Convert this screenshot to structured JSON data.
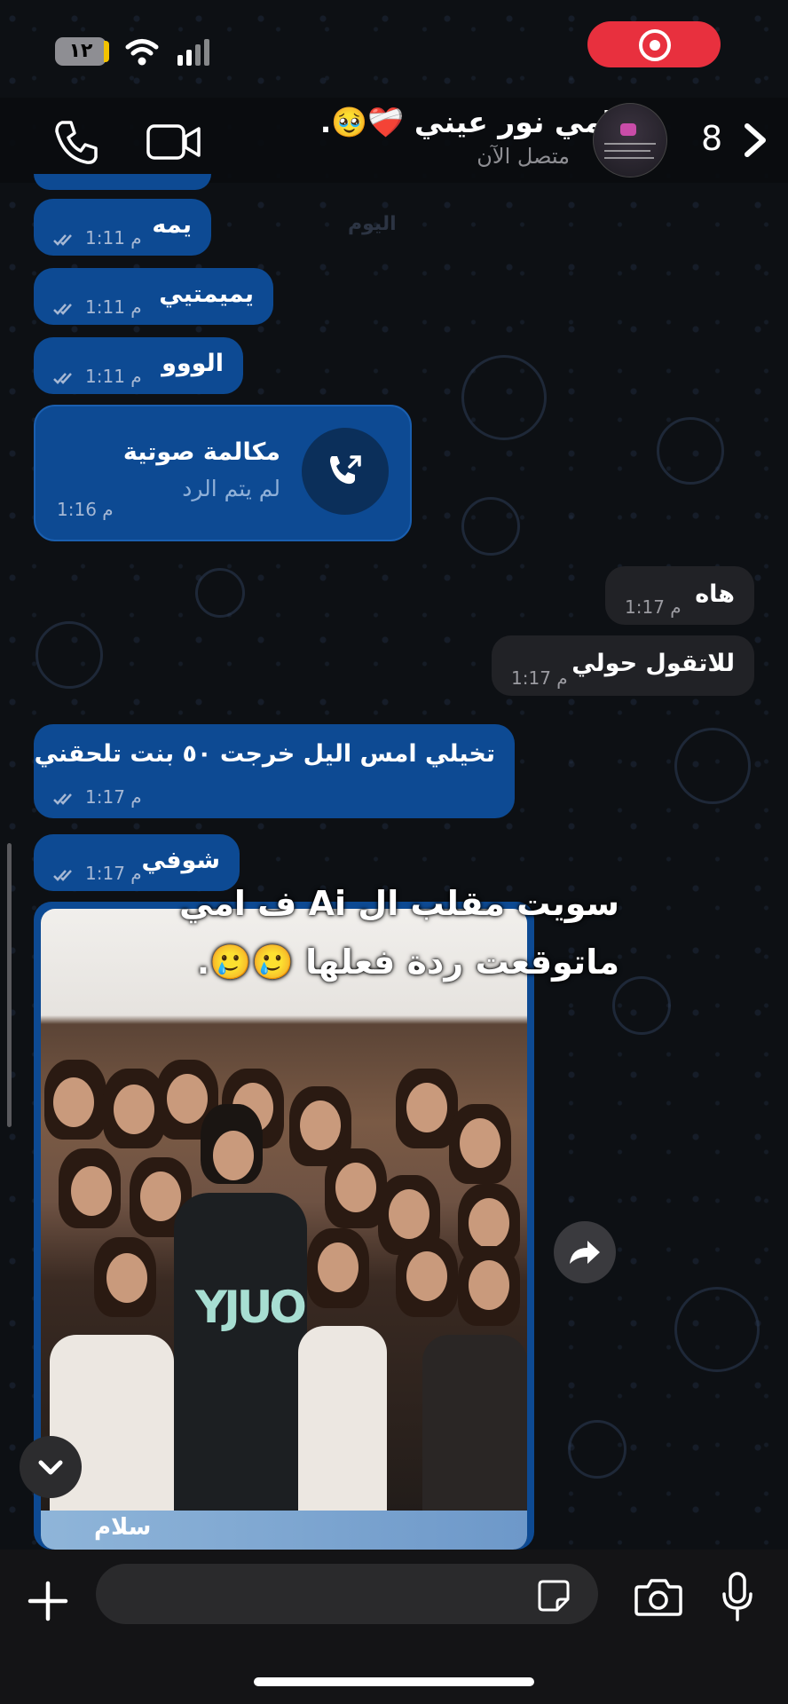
{
  "status_bar": {
    "battery": "١٢",
    "recording_color": "#e8303e"
  },
  "header": {
    "unread_count": "8",
    "name": "امي نور عيني ❤️‍🩹🥹.",
    "status": "متصل الآن",
    "icons": [
      "phone-icon",
      "video-camera-icon",
      "avatar",
      "chevron-left-icon"
    ]
  },
  "chat": {
    "date_label": "اليوم",
    "messages": [
      {
        "dir": "in",
        "text": "يمه",
        "time": "1:11 م"
      },
      {
        "dir": "in",
        "text": "يميمتيي",
        "time": "1:11 م"
      },
      {
        "dir": "in",
        "text": "الووو",
        "time": "1:11 م"
      },
      {
        "dir": "in",
        "type": "call",
        "title": "مكالمة صوتية",
        "subtitle": "لم يتم الرد",
        "time": "1:16 م"
      },
      {
        "dir": "out",
        "text": "هاه",
        "time": "1:17 م"
      },
      {
        "dir": "out",
        "text": "للاتقول حولي",
        "time": "1:17 م"
      },
      {
        "dir": "in",
        "text": "تخيلي امس اليل خرجت ٥٠ بنت تلحقني",
        "time": "1:17 م"
      },
      {
        "dir": "in",
        "text": "شوفي",
        "time": "1:17 م"
      }
    ],
    "image": {
      "hoodie_text": "YJUO",
      "footer_text": "سلام"
    }
  },
  "overlay": {
    "line1": "سويت مقلب ال Ai ف امي",
    "line2": "ماتوقعت ردة فعلها 🥲🥲."
  },
  "input": {
    "placeholder": ""
  },
  "colors": {
    "incoming_bubble": "#0d4a93",
    "outgoing_bubble": "#212226",
    "background": "#0d1014"
  }
}
